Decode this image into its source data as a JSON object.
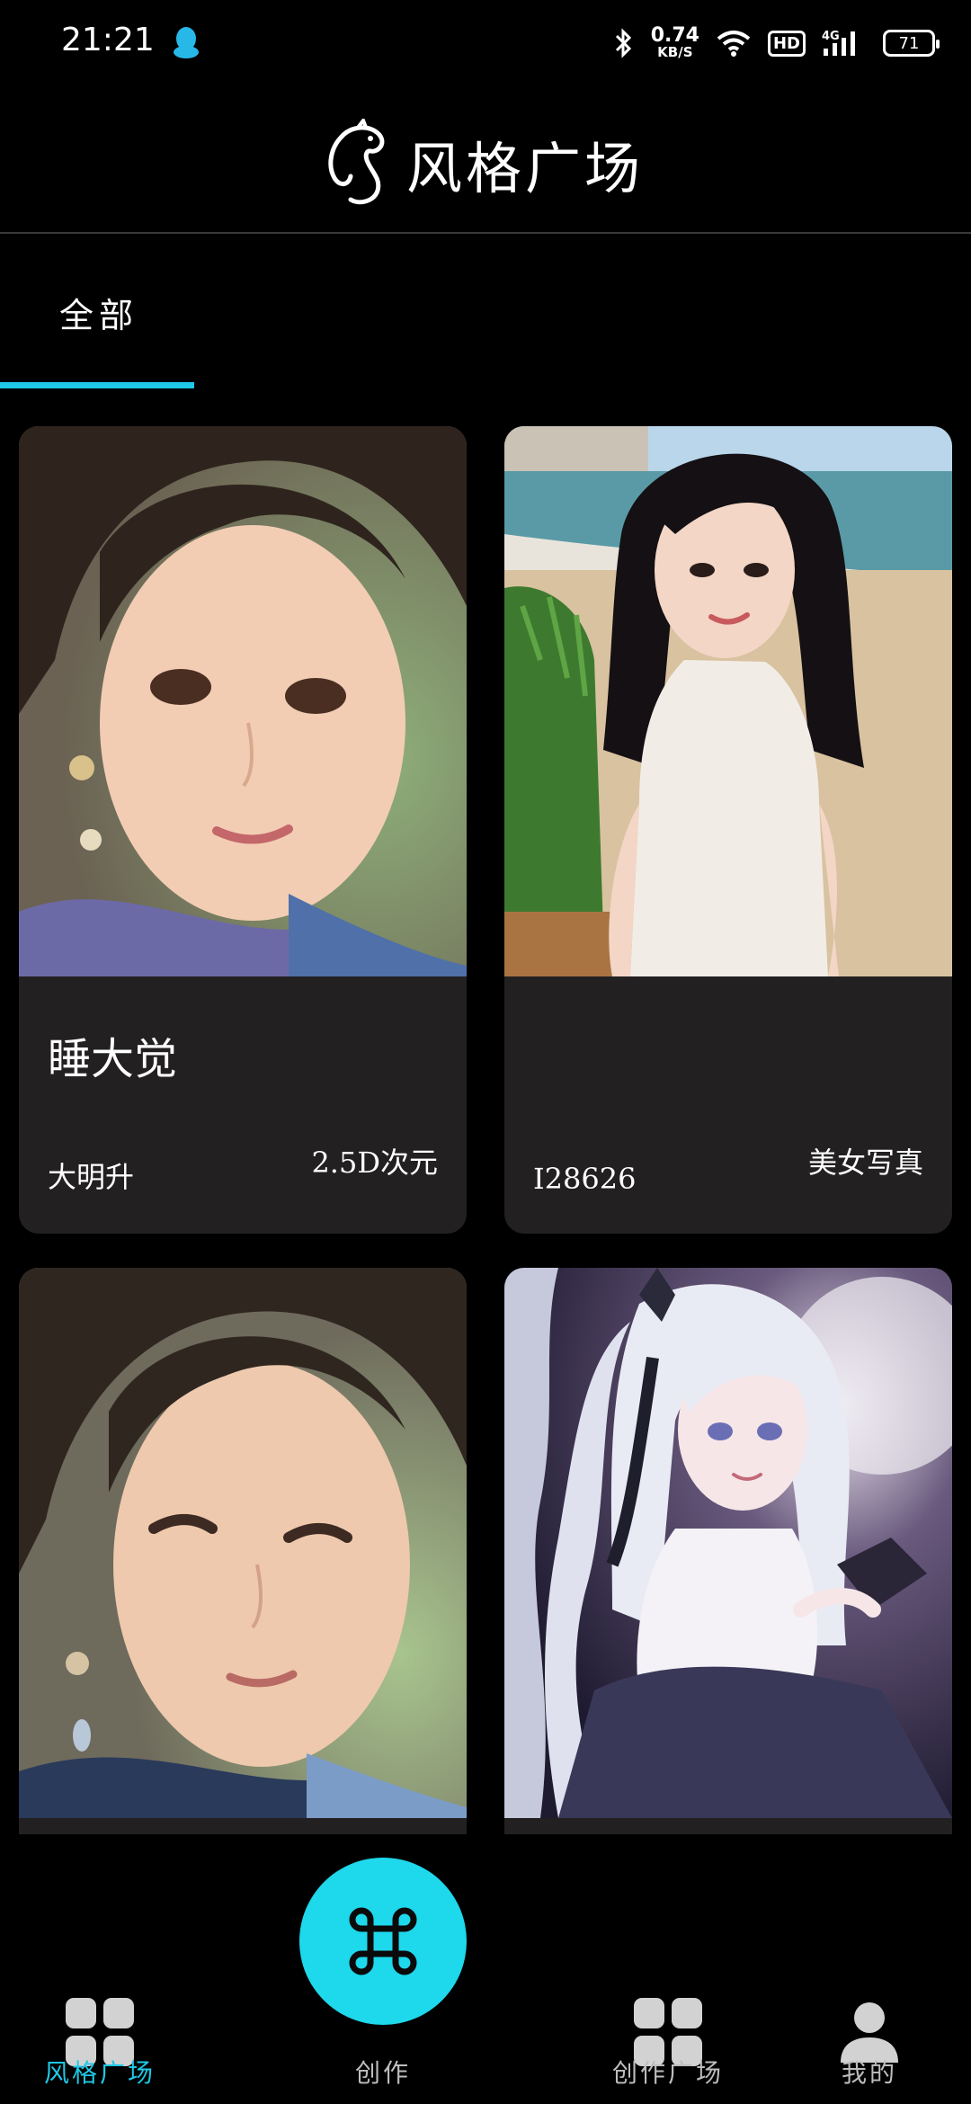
{
  "status_bar": {
    "time": "21:21",
    "net_speed": "0.74",
    "net_unit": "KB/S",
    "hd": "HD",
    "signal": "4G",
    "battery": "71"
  },
  "header": {
    "title": "风格广场"
  },
  "tabs": [
    {
      "label": "全部",
      "active": true
    }
  ],
  "cards": [
    {
      "title": "睡大觉",
      "author": "大明升",
      "tag": "2.5D次元"
    },
    {
      "title": "",
      "author": "I28626",
      "tag": "美女写真"
    },
    {
      "title": "",
      "author": "",
      "tag": ""
    },
    {
      "title": "",
      "author": "",
      "tag": ""
    }
  ],
  "bottom_nav": {
    "items": [
      {
        "label": "风格广场"
      },
      {
        "label": "创作"
      },
      {
        "label": "创作广场"
      },
      {
        "label": "我的"
      }
    ]
  },
  "colors": {
    "accent": "#1ec8e6",
    "card_bg": "#232022",
    "background": "#000000"
  }
}
